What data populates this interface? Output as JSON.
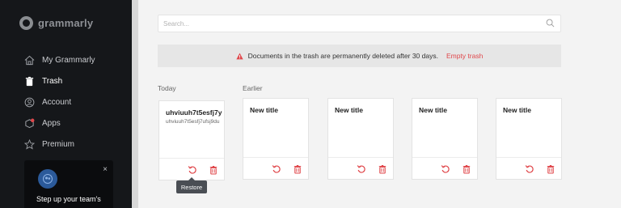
{
  "sidebar": {
    "logo_text": "grammarly",
    "items": [
      {
        "label": "My Grammarly",
        "icon": "home-icon"
      },
      {
        "label": "Trash",
        "icon": "trash-icon"
      },
      {
        "label": "Account",
        "icon": "account-icon"
      },
      {
        "label": "Apps",
        "icon": "apps-icon"
      },
      {
        "label": "Premium",
        "icon": "star-icon"
      }
    ],
    "promo": {
      "text": "Step up your team's",
      "close": "×"
    }
  },
  "search": {
    "placeholder": "Search..."
  },
  "banner": {
    "message": "Documents in the trash are permanently deleted after 30 days.",
    "link": "Empty trash"
  },
  "sections": {
    "today": "Today",
    "earlier": "Earlier"
  },
  "documents": [
    {
      "title": "uhviuuh7t5esfj7y",
      "preview": "uhviuuh7t5esfj7ufsj9du"
    },
    {
      "title": "New title",
      "preview": ""
    },
    {
      "title": "New title",
      "preview": ""
    },
    {
      "title": "New title",
      "preview": ""
    },
    {
      "title": "New title",
      "preview": ""
    }
  ],
  "tooltip": "Restore",
  "colors": {
    "accent": "#e0484c",
    "sidebar": "#15171a"
  }
}
